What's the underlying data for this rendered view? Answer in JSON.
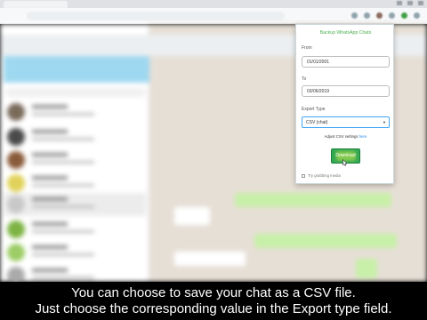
{
  "popup": {
    "title": "Backup WhatsApp Chats",
    "from_label": "From",
    "from_value": "01/01/2001",
    "to_label": "To",
    "to_value": "03/06/2019",
    "export_type_label": "Export Type",
    "export_type_value": "CSV (chat)",
    "csv_settings_text": "Adjust CSV settings",
    "csv_settings_link": "here",
    "download_label": "Download",
    "grab_media_label": "Try grabbing media"
  },
  "caption": {
    "line1": "You can choose to save your chat as a CSV file.",
    "line2": "Just choose the corresponding value in the Export type field."
  },
  "colors": {
    "accent": "#4caf50",
    "download_button": "#34a853",
    "select_border": "#42a5f5",
    "link": "#1e88e5",
    "notice_banner": "#9ed8f0"
  },
  "icons": {
    "caret": "chevron-down-icon",
    "cursor": "mouse-pointer-icon"
  }
}
